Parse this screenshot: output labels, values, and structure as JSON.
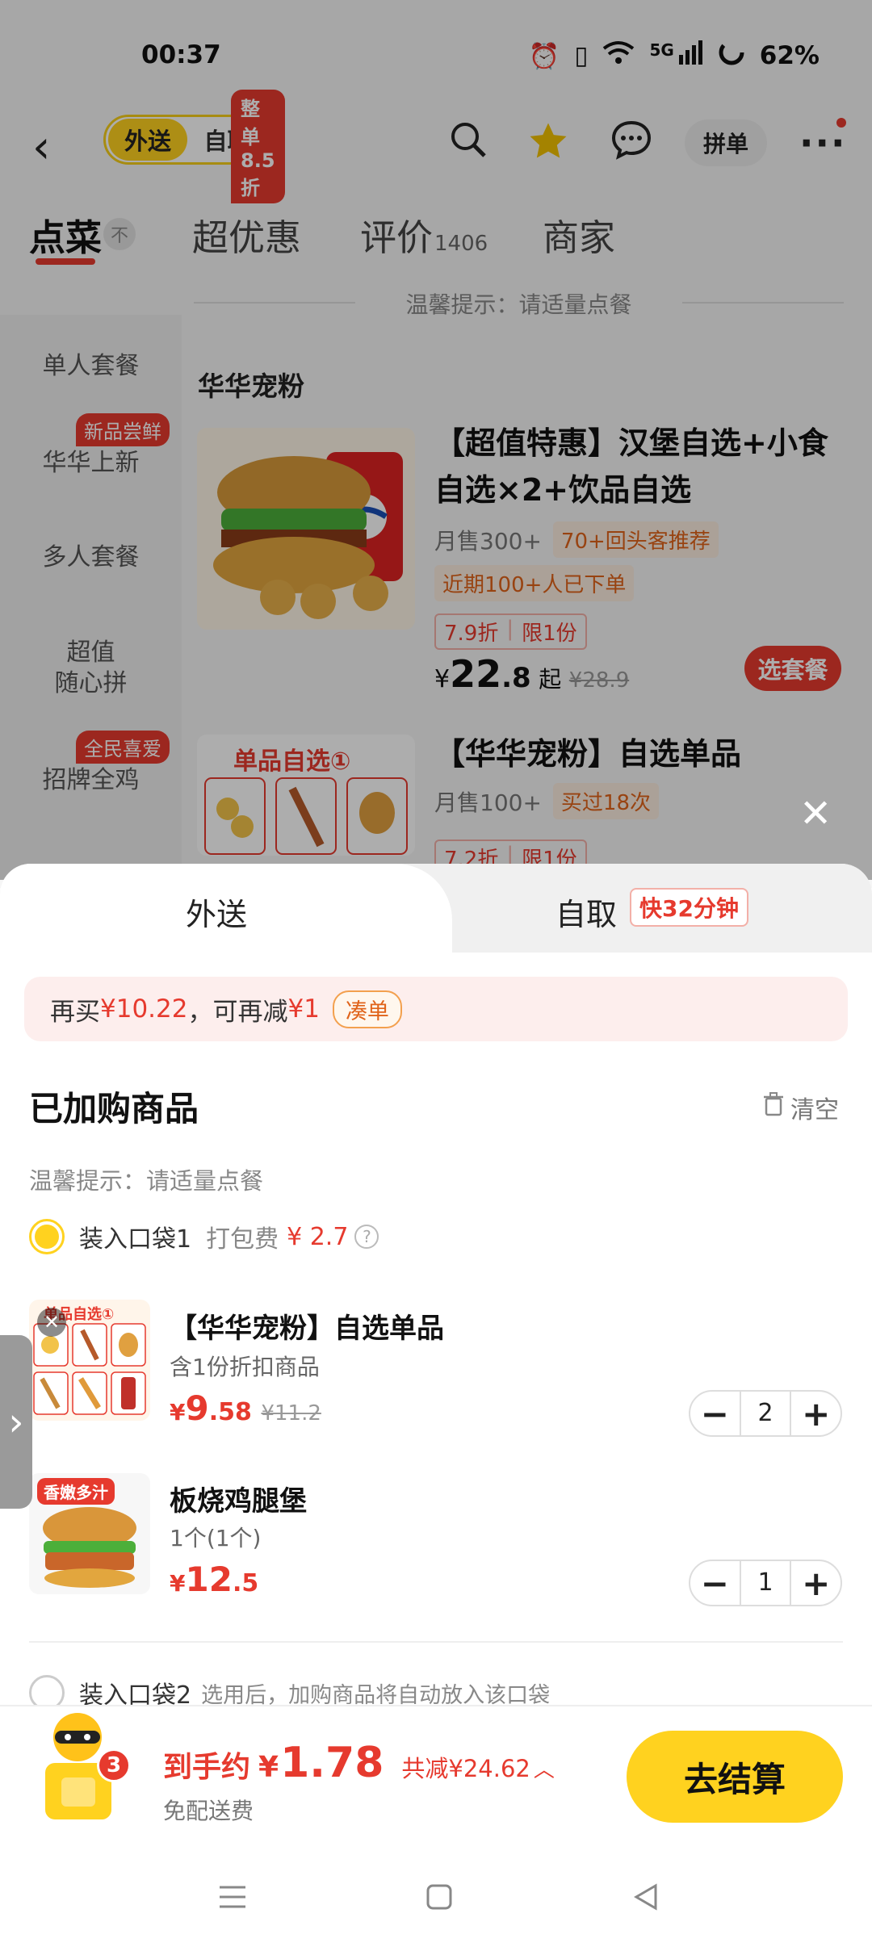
{
  "status_bar": {
    "time": "00:37",
    "battery": "62%",
    "network": "5G"
  },
  "top_bar": {
    "mode_active": "外送",
    "mode_inactive": "自取",
    "mode_tag": "整单8.5折",
    "group_order": "拼单"
  },
  "tabs": [
    {
      "label": "点菜",
      "badge": "不"
    },
    {
      "label": "超优惠"
    },
    {
      "label": "评价",
      "count": "1406"
    },
    {
      "label": "商家"
    }
  ],
  "tip": "温馨提示：请适量点餐",
  "sidebar": {
    "items": [
      {
        "label": "单人套餐"
      },
      {
        "label": "华华上新",
        "badge": "新品尝鲜"
      },
      {
        "label": "多人套餐"
      },
      {
        "label": "超值",
        "label2": "随心拼"
      },
      {
        "label": "招牌全鸡",
        "badge": "全民喜爱"
      }
    ]
  },
  "category": {
    "title": "华华宠粉"
  },
  "products": [
    {
      "title": "【超值特惠】汉堡自选+小食自选×2+饮品自选",
      "sales": "月售300+",
      "chip1": "70+回头客推荐",
      "chip2": "近期100+人已下单",
      "discount": "7.9折",
      "limit": "限1份",
      "currency": "¥",
      "price_int": "22",
      "price_dec": ".8",
      "price_suffix": "起",
      "original": "¥28.9",
      "action": "选套餐"
    },
    {
      "title": "【华华宠粉】自选单品",
      "sales": "月售100+",
      "chip1": "买过18次",
      "discount": "7.2折",
      "limit": "限1份",
      "img_label": "单品自选①"
    }
  ],
  "sheet": {
    "tab_delivery": "外送",
    "tab_pickup": "自取",
    "pickup_tag": "快32分钟",
    "promo_prefix": "再买",
    "promo_amount": "¥10.22",
    "promo_mid": "，可再减",
    "promo_discount": "¥1",
    "promo_pill": "凑单",
    "added_title": "已加购商品",
    "clear": "清空",
    "warm_tip": "温馨提示：请适量点餐",
    "bag1_label": "装入口袋1",
    "bag1_fee_label": "打包费",
    "bag1_fee": "¥ 2.7",
    "bag2_label": "装入口袋2",
    "bag2_tip": "选用后，加购商品将自动放入该口袋",
    "items": [
      {
        "name": "【华华宠粉】自选单品",
        "sub": "含1份折扣商品",
        "currency": "¥",
        "price_int": "9",
        "price_dec": ".58",
        "original": "¥11.2",
        "qty": "2",
        "img_label": "单品自选①"
      },
      {
        "name": "板烧鸡腿堡",
        "sub": "1个(1个)",
        "currency": "¥",
        "price_int": "12",
        "price_dec": ".5",
        "qty": "1",
        "img_label": "香嫩多汁"
      }
    ]
  },
  "bottom": {
    "cart_count": "3",
    "label": "到手约",
    "currency": "¥",
    "total": "1.78",
    "saving": "共减¥24.62",
    "delivery": "免配送费",
    "checkout": "去结算"
  },
  "colors": {
    "accent": "#ffd21f",
    "red": "#e63a2e",
    "orange": "#e0631a"
  }
}
